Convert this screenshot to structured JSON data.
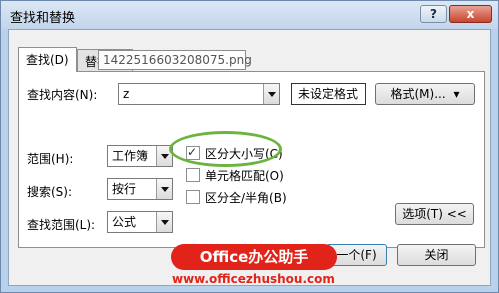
{
  "window": {
    "title": "查找和替换",
    "help": "?",
    "close": "x"
  },
  "tabs": [
    {
      "label": "查找(D)"
    },
    {
      "label": "替换(P)"
    }
  ],
  "tooltip": "1422516603208075.png",
  "find": {
    "label": "查找内容(N):",
    "value": "z",
    "format_status": "未设定格式",
    "format_button": "格式(M)..."
  },
  "options": {
    "scope_label": "范围(H):",
    "scope_value": "工作簿",
    "search_label": "搜索(S):",
    "search_value": "按行",
    "lookin_label": "查找范围(L):",
    "lookin_value": "公式",
    "match_case": {
      "label": "区分大小写(C)",
      "checked": true
    },
    "match_cell": {
      "label": "单元格匹配(O)",
      "checked": false
    },
    "match_byte": {
      "label": "区分全/半角(B)",
      "checked": false
    },
    "options_button": "选项(T) <<"
  },
  "buttons": {
    "find_next": "一个(F)",
    "close": "关闭"
  },
  "watermark": {
    "badge": "Office办公助手",
    "url": "www.officezhushou.com"
  },
  "colors": {
    "highlight_ring": "#6db33f",
    "watermark_red": "#e2231a"
  }
}
